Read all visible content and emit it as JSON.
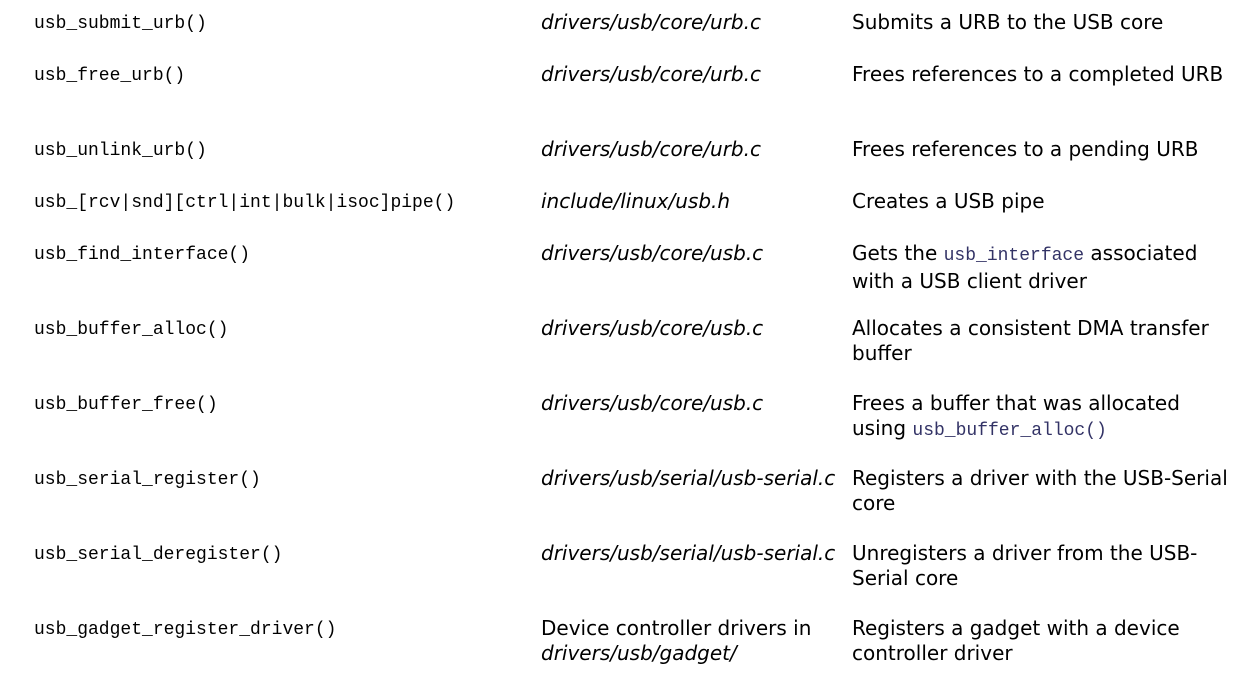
{
  "rows": [
    {
      "function": "usb_submit_urb()",
      "file": "drivers/usb/core/urb.c",
      "description": "Submits a URB to the USB core"
    },
    {
      "function": "usb_free_urb()",
      "file": "drivers/usb/core/urb.c",
      "description": "Frees references to a completed URB"
    },
    {
      "function": "usb_unlink_urb()",
      "file": "drivers/usb/core/urb.c",
      "description": "Frees references to a pending URB"
    },
    {
      "function": "usb_[rcv|snd][ctrl|int|bulk|isoc]pipe()",
      "file": "include/linux/usb.h",
      "description": "Creates a USB pipe"
    },
    {
      "function": "usb_find_interface()",
      "file": "drivers/usb/core/usb.c",
      "description_pre": "Gets the ",
      "description_code": "usb_interface",
      "description_post": " associated with a USB client driver"
    },
    {
      "function": "usb_buffer_alloc()",
      "file": "drivers/usb/core/usb.c",
      "description": "Allocates a consistent DMA transfer buffer"
    },
    {
      "function": "usb_buffer_free()",
      "file": "drivers/usb/core/usb.c",
      "description_pre": "Frees a buffer that was allocated using ",
      "description_code": "usb_buffer_alloc()"
    },
    {
      "function": "usb_serial_register()",
      "file": "drivers/usb/serial/usb-serial.c",
      "description": "Registers a driver with the USB-Serial core"
    },
    {
      "function": "usb_serial_deregister()",
      "file": "drivers/usb/serial/usb-serial.c",
      "description": "Unregisters a driver from the USB-Serial core"
    },
    {
      "function": "usb_gadget_register_driver()",
      "file_pre": "Device controller drivers in ",
      "file": "drivers/usb/gadget/",
      "description": "Registers a gadget with a device controller driver"
    }
  ]
}
